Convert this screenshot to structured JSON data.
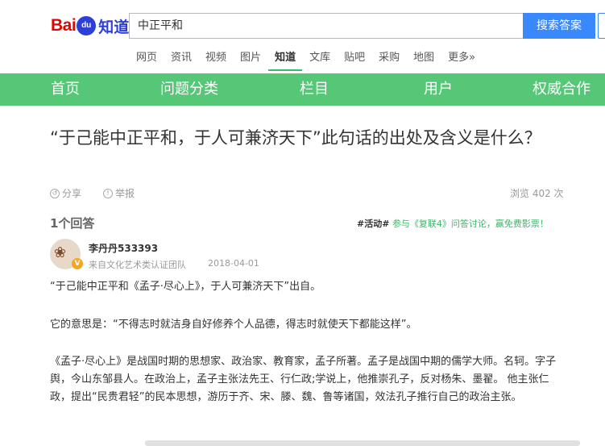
{
  "logo": {
    "text_left": "Bai",
    "text_paw": "du",
    "text_right": "知道"
  },
  "search": {
    "value": "中正平和",
    "button": "搜索答案"
  },
  "nav_tabs": [
    "网页",
    "资讯",
    "视频",
    "图片",
    "知道",
    "文库",
    "贴吧",
    "采购",
    "地图",
    "更多»"
  ],
  "active_tab": "知道",
  "green_nav": [
    "首页",
    "问题分类",
    "栏目",
    "用户",
    "权威合作"
  ],
  "colors": {
    "green": "#55c776",
    "blue": "#3a88fd",
    "red": "#e10602",
    "accent_green": "#38b868"
  },
  "question": {
    "title": "“于己能中正平和，于人可兼济天下”此句话的出处及含义是什么？",
    "share": "分享",
    "report": "举报",
    "views": "浏览 402 次"
  },
  "answers": {
    "count": "1个回答",
    "activity_tag": "#活动#",
    "activity_text": "参与《复联4》问答讨论，赢免费影票！"
  },
  "answer": {
    "username": "李丹丹533393",
    "cert": "来自文化艺术类认证团队",
    "date": "2018-04-01",
    "p1": "“于己能中正平和《孟子·尽心上》，于人可兼济天下”出自。",
    "p2": "它的意思是：“不得志时就洁身自好修养个人品德，得志时就使天下都能这样”。",
    "p3": "《孟子·尽心上》是战国时期的思想家、政治家、教育家，孟子所著。孟子是战国中期的儒学大师。名轲。字子舆，今山东邹县人。在政治上，孟子主张法先王、行仁政;学说上，他推崇孔子，反对杨朱、墨翟。 他主张仁政，提出“民贵君轻”的民本思想，游历于齐、宋、滕、魏、鲁等诸国，效法孔子推行自己的政治主张。"
  },
  "icons": {
    "share": "share-icon",
    "report": "report-icon",
    "badge": "verified-badge-icon"
  }
}
